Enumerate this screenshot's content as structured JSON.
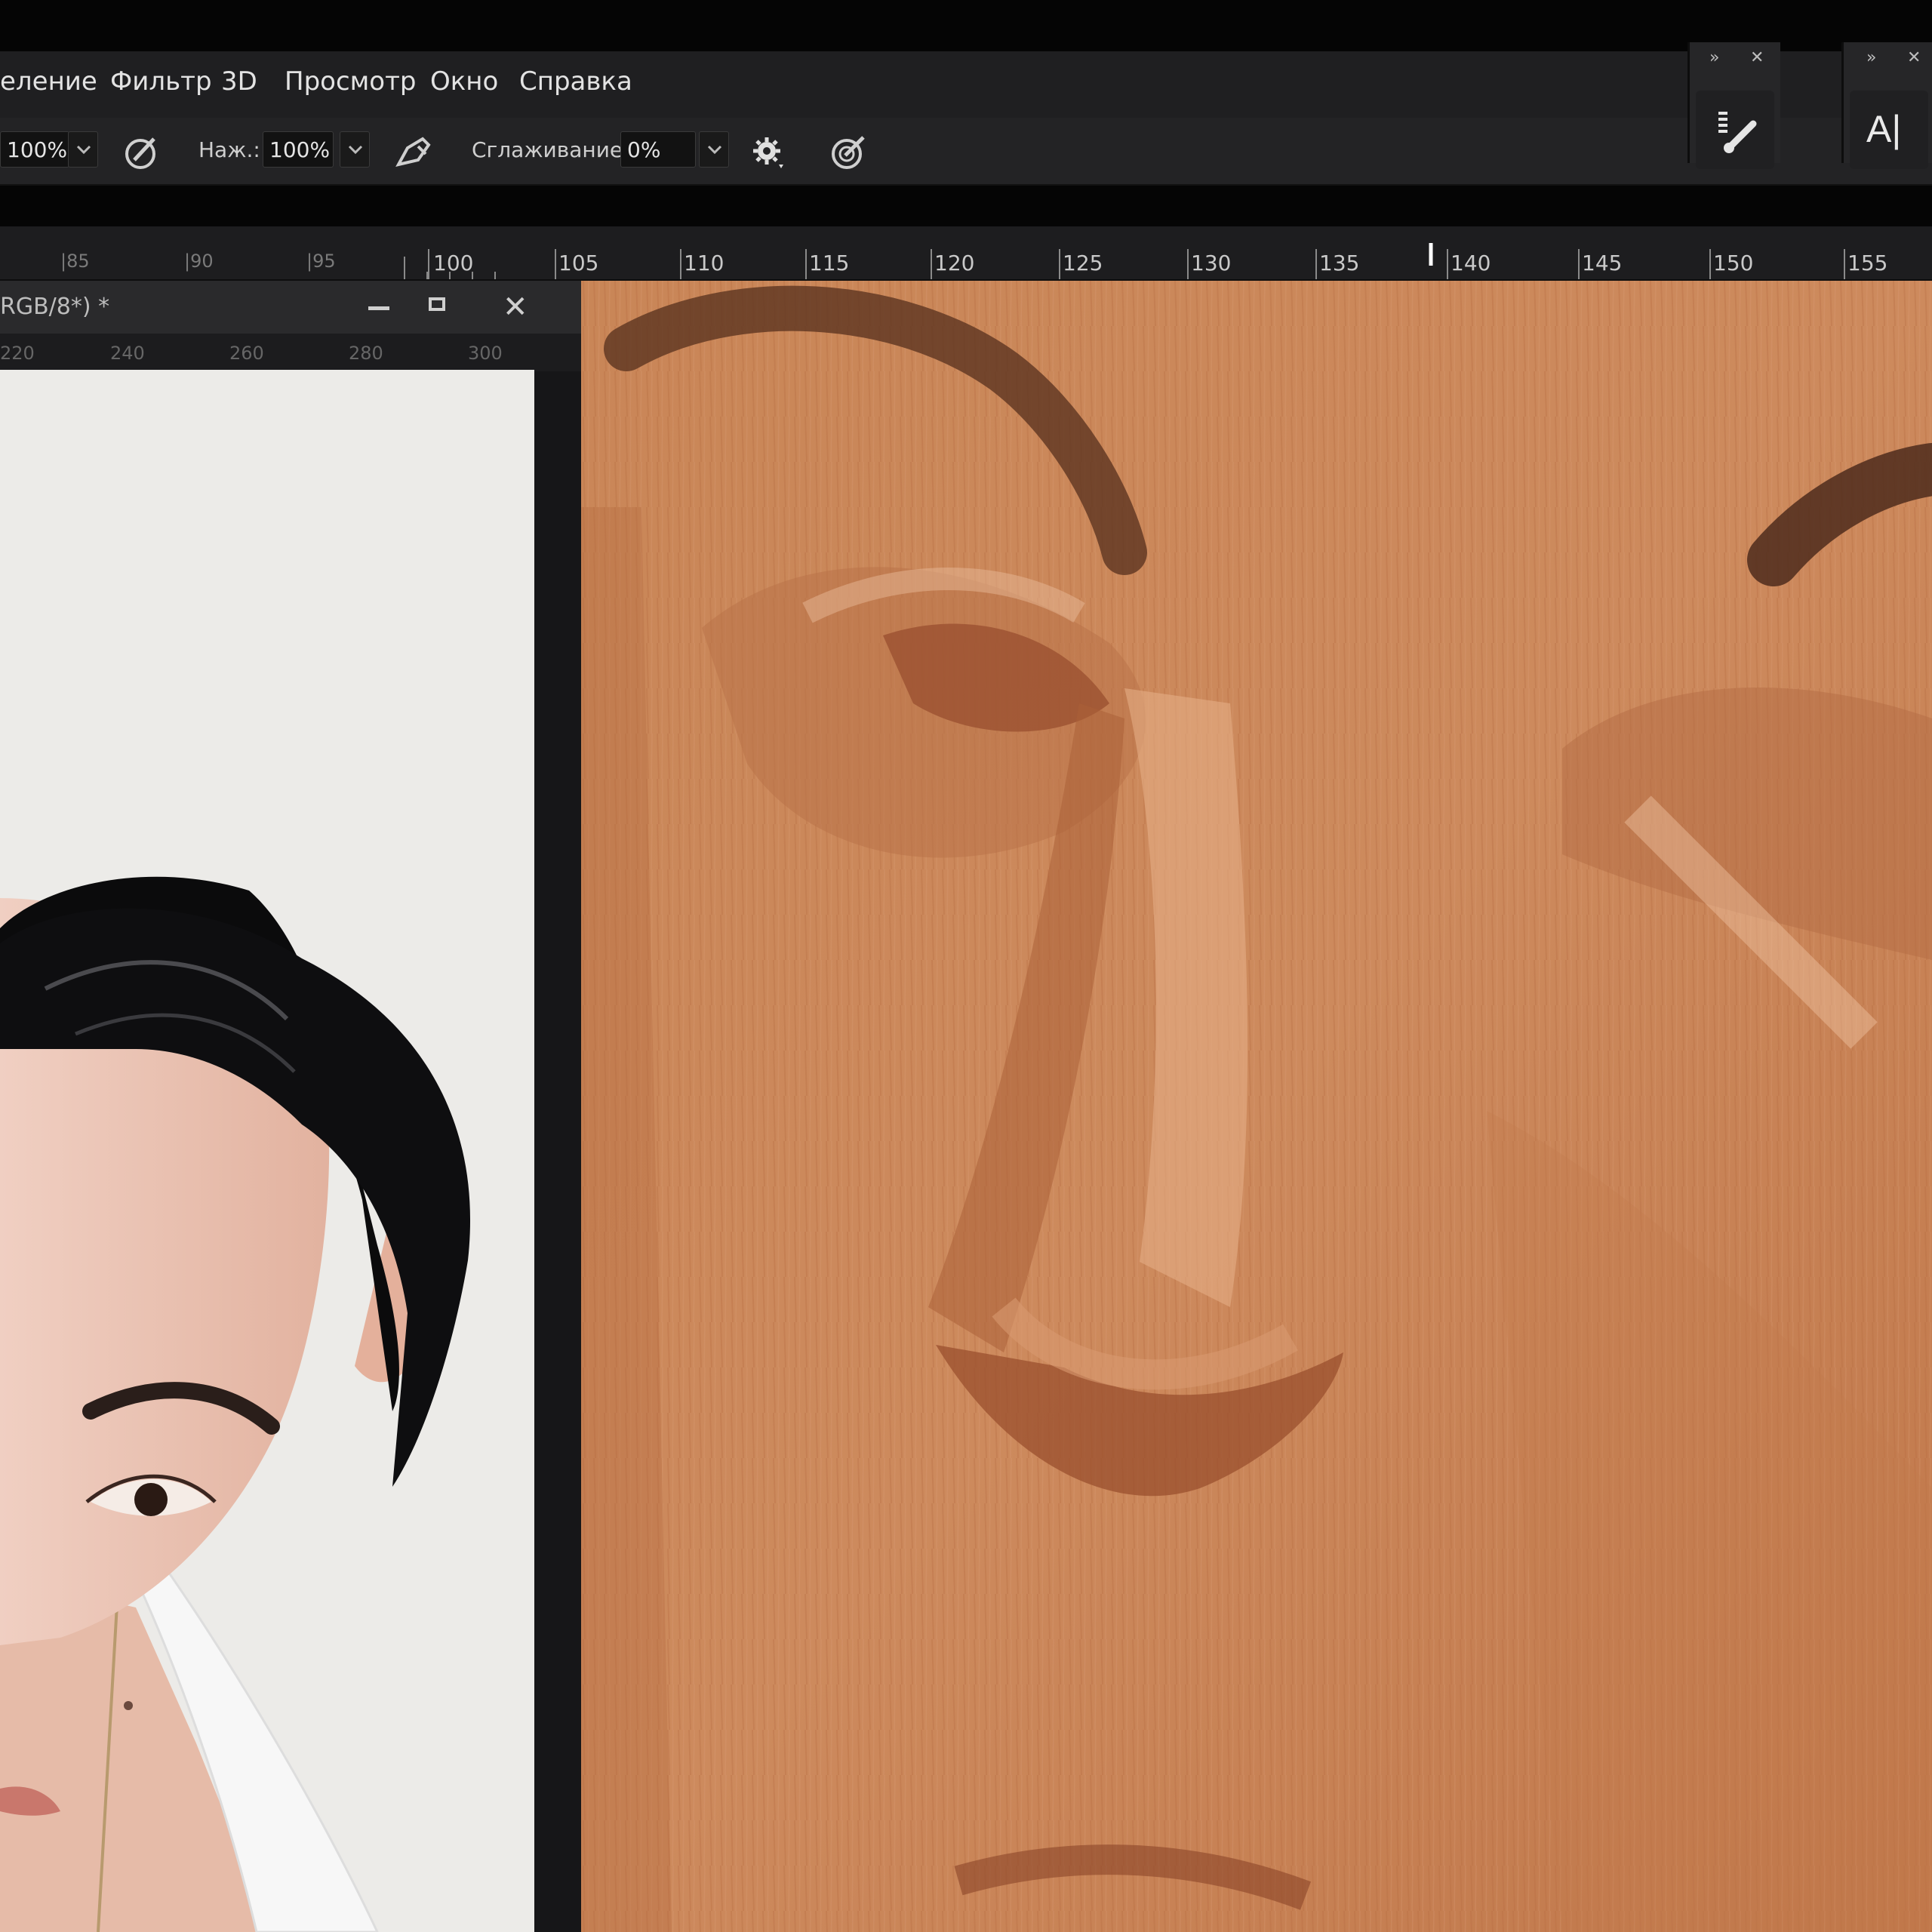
{
  "menu": {
    "items": [
      "еление",
      "Фильтр",
      "3D",
      "Просмотр",
      "Окно",
      "Справка"
    ]
  },
  "options": {
    "opacity_value": "100%",
    "pressure_label": "Наж.:",
    "pressure_value": "100%",
    "smoothing_label": "Сглаживание:",
    "smoothing_value": "0%"
  },
  "panels": {
    "type_icon_label": "A|"
  },
  "ruler": {
    "faint_labels": [
      "|85",
      "|90",
      "|95"
    ],
    "labels": [
      "100",
      "105",
      "110",
      "115",
      "120",
      "125",
      "130",
      "135",
      "140",
      "145",
      "150",
      "155"
    ]
  },
  "document": {
    "title": "RGB/8*) *",
    "ruler_labels": [
      "220",
      "240",
      "260",
      "280",
      "300"
    ]
  }
}
